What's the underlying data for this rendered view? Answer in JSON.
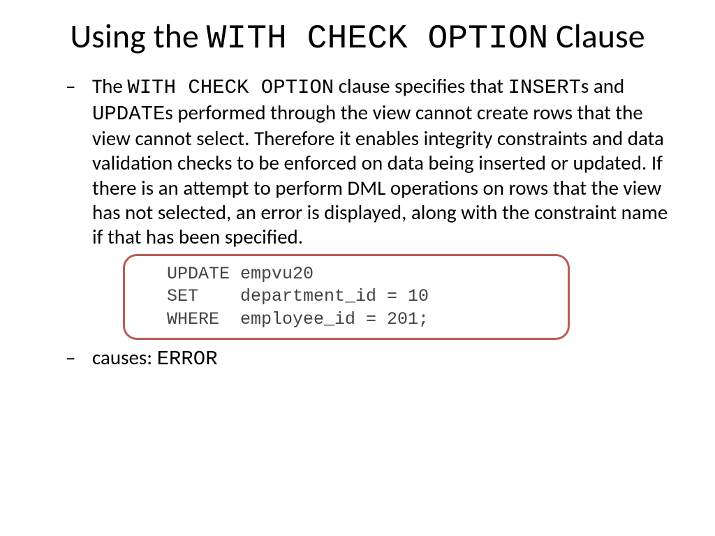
{
  "title": {
    "pre": "Using the ",
    "mono": "WITH CHECK OPTION",
    "post": " Clause"
  },
  "bullet1": {
    "t1": "The ",
    "m1": "WITH CHECK OPTION",
    "t2": " clause specifies that ",
    "m2": "INSERT",
    "t3": "s and ",
    "m3": "UPDATE",
    "t4": "s performed through the view cannot create rows that the view cannot select. Therefore it enables integrity constraints and data validation checks to be enforced on data being inserted or updated. If there is an attempt to perform DML operations on rows that the view has not selected, an error is displayed, along with the constraint name if that has been specified."
  },
  "code": "UPDATE empvu20\nSET    department_id = 10\nWHERE  employee_id = 201;",
  "bullet2": {
    "t1": "causes: ",
    "m1": "ERROR"
  }
}
